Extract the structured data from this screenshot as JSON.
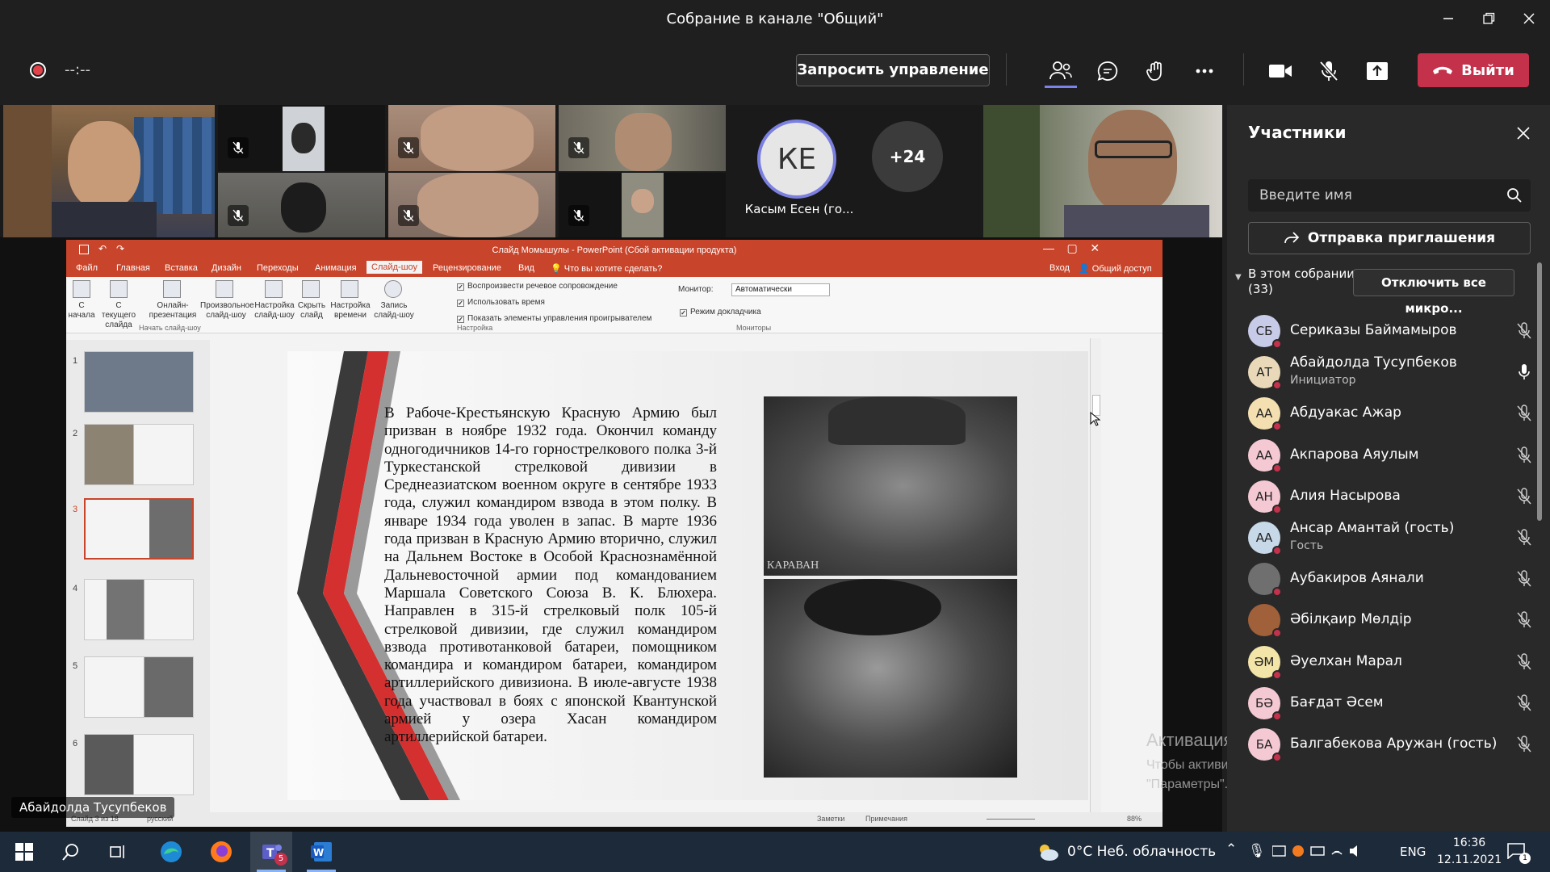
{
  "window": {
    "title": "Собрание в канале \"Общий\""
  },
  "toolbar": {
    "timer": "--:--",
    "request_control": "Запросить управление",
    "leave": "Выйти"
  },
  "gallery": {
    "initials": "КЕ",
    "ke_name": "Касым Есен (го...",
    "more_count": "+24",
    "presenter_name": "Абайдолда Тусупбеков"
  },
  "ppt": {
    "title": "Слайд Момышулы - PowerPoint (Сбой активации продукта)",
    "tabs": [
      "Файл",
      "Главная",
      "Вставка",
      "Дизайн",
      "Переходы",
      "Анимация",
      "Слайд-шоу",
      "Рецензирование",
      "Вид"
    ],
    "tell_me": "Что вы хотите сделать?",
    "signin": "Вход",
    "share": "Общий доступ",
    "ribbon": {
      "from_start": "С начала",
      "from_current": "С текущего слайда",
      "online": "Онлайн-презентация",
      "custom": "Произвольное слайд-шоу",
      "setup": "Настройка слайд-шоу",
      "hide": "Скрыть слайд",
      "rehearse": "Настройка времени",
      "record": "Запись слайд-шоу",
      "group_start": "Начать слайд-шоу",
      "chk1": "Воспроизвести речевое сопровождение",
      "chk2": "Использовать время",
      "chk3": "Показать элементы управления проигрывателем",
      "group_setup": "Настройка",
      "monitor_label": "Монитор:",
      "monitor_value": "Автоматически",
      "presenter_view": "Режим докладчика",
      "group_monitors": "Мониторы"
    },
    "slide_numbers": [
      "1",
      "2",
      "3",
      "4",
      "5",
      "6"
    ],
    "slide_text": "В Рабоче-Крестьянскую Красную Армию был призван в ноябре 1932 года. Окончил команду одногодичников 14-го горнострелкового полка 3-й Туркестанской стрелковой дивизии в Среднеазиатском военном округе в сентябре 1933 года, служил командиром взвода в этом полку. В январе 1934 года уволен в запас. В марте 1936 года призван в Красную Армию вторично, служил на Дальнем Востоке в Особой Краснознамённой Дальневосточной армии под командованием Маршала Советского Союза В. К. Блюхера. Направлен в 315-й стрелковый полк 105-й стрелковой дивизии, где служил командиром взвода противотанковой батареи, помощником командира и командиром батареи, командиром артиллерийского дивизиона. В июле-августе 1938 года участвовал в боях с японской Квантунской армией у озера Хасан командиром артиллерийской батареи.",
    "photo_caption": "КАРАВАН",
    "status": {
      "slide": "Слайд 3 из 18",
      "lang": "русский",
      "notes": "Заметки",
      "comments": "Примечания",
      "zoom": "88%"
    }
  },
  "activation": {
    "title": "Активация Windows",
    "body": "Чтобы активировать Windows, перейдите в раздел \"Параметры\"."
  },
  "panel": {
    "title": "Участники",
    "search_placeholder": "Введите имя",
    "invite": "Отправка приглашения",
    "section": "В этом собрании",
    "count": "(33)",
    "mute_all": "Отключить все микро...",
    "participants": [
      {
        "initials": "СБ",
        "name": "Сериказы Баймамыров",
        "role": "",
        "color": "#c7cbe8"
      },
      {
        "initials": "АТ",
        "name": "Абайдолда Тусупбеков",
        "role": "Инициатор",
        "color": "#e9d9b9"
      },
      {
        "initials": "АА",
        "name": "Абдуакас Ажар",
        "role": "",
        "color": "#f3dfb0"
      },
      {
        "initials": "АА",
        "name": "Акпарова Аяулым",
        "role": "",
        "color": "#f4c9d3"
      },
      {
        "initials": "АН",
        "name": "Алия Насырова",
        "role": "",
        "color": "#f4c9d3"
      },
      {
        "initials": "АА",
        "name": "Ансар Амантай (гость)",
        "role": "Гость",
        "color": "#c7d8e8"
      },
      {
        "initials": "",
        "name": "Аубакиров Аянали",
        "role": "",
        "color": "#6f6f6f"
      },
      {
        "initials": "",
        "name": "Әбілқаир Мөлдір",
        "role": "",
        "color": "#a0603a"
      },
      {
        "initials": "ӘМ",
        "name": "Әуелхан Марал",
        "role": "",
        "color": "#f3e4a8"
      },
      {
        "initials": "БӘ",
        "name": "Бағдат Әсем",
        "role": "",
        "color": "#f4c9d3"
      },
      {
        "initials": "БА",
        "name": "Балгабекова Аружан (гость)",
        "role": "",
        "color": "#f4c9d3"
      }
    ]
  },
  "taskbar": {
    "weather": "0°C  Неб. облачность",
    "lang": "ENG",
    "time": "16:36",
    "date": "12.11.2021",
    "teams_badge": "5",
    "notif": "1"
  }
}
